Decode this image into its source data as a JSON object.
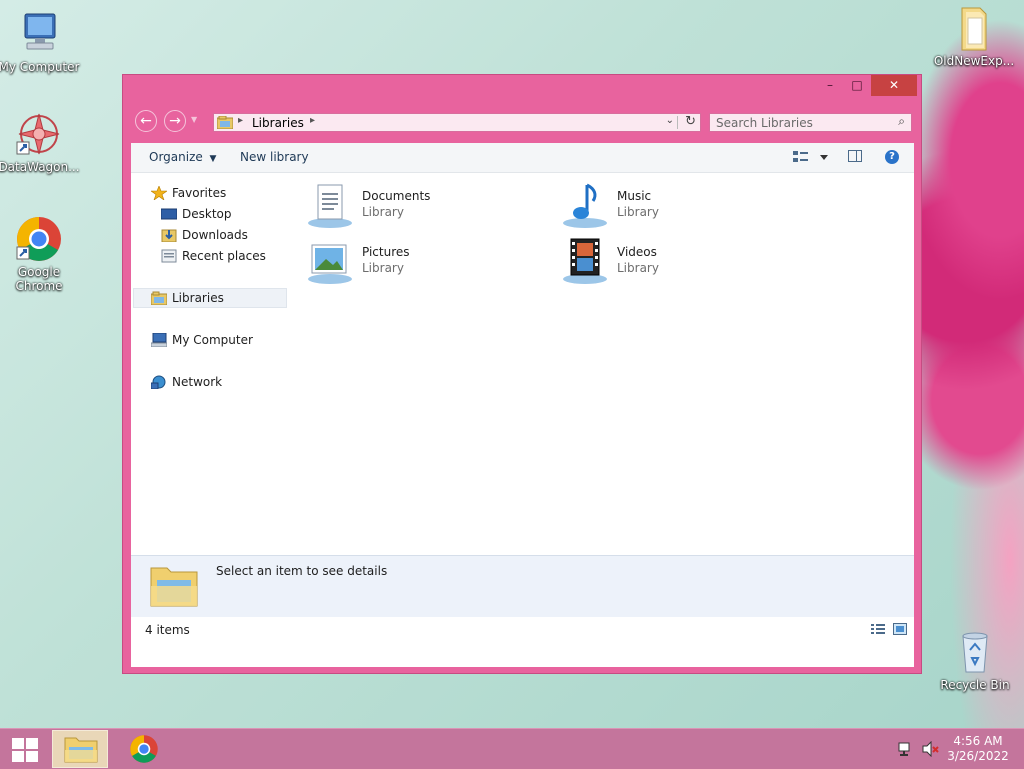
{
  "desktop": {
    "icons": [
      {
        "label": "My Computer",
        "icon": "computer-icon"
      },
      {
        "label": "DataWagon...",
        "icon": "datawagon-icon"
      },
      {
        "label": "Google Chrome",
        "icon": "chrome-icon"
      },
      {
        "label": "OldNewExp...",
        "icon": "folder-icon"
      },
      {
        "label": "Recycle Bin",
        "icon": "recycle-bin-icon"
      }
    ]
  },
  "window": {
    "title_buttons": {
      "minimize": "–",
      "maximize": "□",
      "close": "✕"
    },
    "address": {
      "crumb": "Libraries"
    },
    "search": {
      "placeholder": "Search Libraries"
    },
    "toolbar": {
      "organize": "Organize",
      "new_library": "New library"
    },
    "nav": {
      "favorites": "Favorites",
      "desktop": "Desktop",
      "downloads": "Downloads",
      "recent": "Recent places",
      "libraries": "Libraries",
      "computer": "My Computer",
      "network": "Network"
    },
    "libraries": [
      {
        "name": "Documents",
        "type": "Library"
      },
      {
        "name": "Music",
        "type": "Library"
      },
      {
        "name": "Pictures",
        "type": "Library"
      },
      {
        "name": "Videos",
        "type": "Library"
      }
    ],
    "details": {
      "text": "Select an item to see details"
    },
    "status": {
      "count": "4 items"
    }
  },
  "taskbar": {
    "clock": {
      "time": "4:56 AM",
      "date": "3/26/2022"
    }
  },
  "colors": {
    "window_frame": "#e8639e",
    "taskbar": "#c4759c",
    "close_button": "#c74242"
  }
}
